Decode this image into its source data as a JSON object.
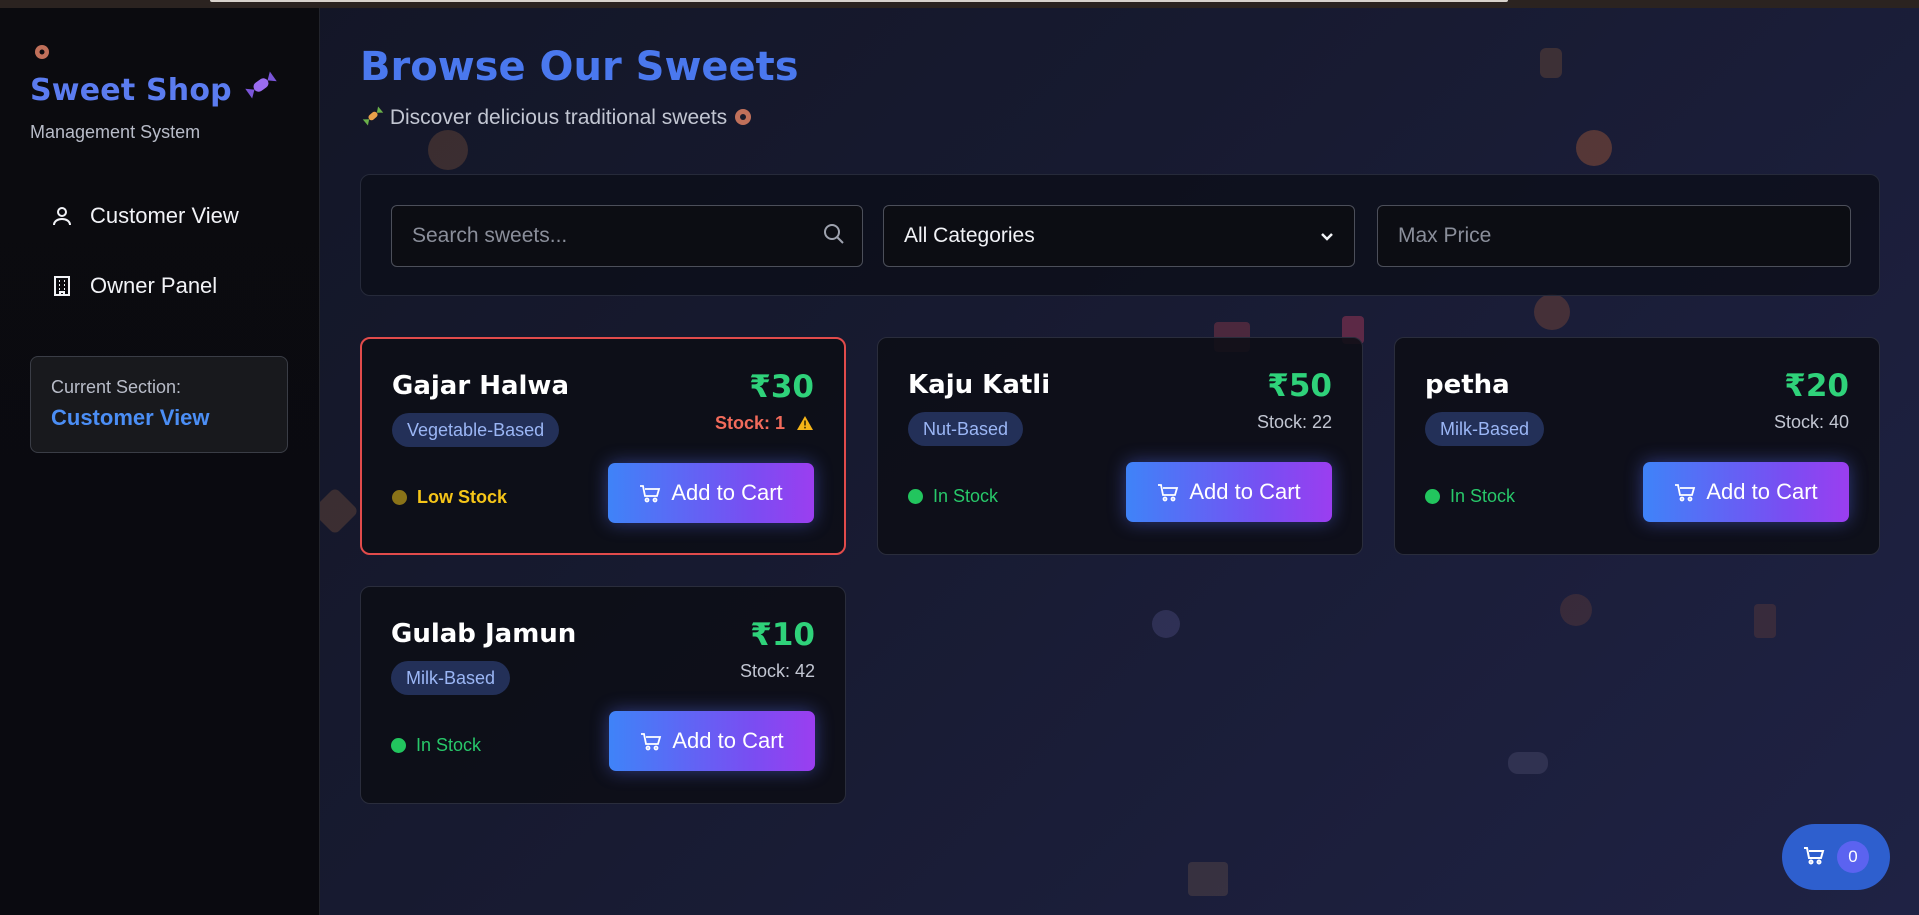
{
  "sidebar": {
    "brand_icon": "donut-emoji",
    "brand_title": "Sweet Shop",
    "brand_title_icon": "candy-icon",
    "brand_subtitle": "Management System",
    "nav": [
      {
        "label": "Customer View",
        "icon": "user-icon"
      },
      {
        "label": "Owner Panel",
        "icon": "building-icon"
      }
    ],
    "current_section_label": "Current Section:",
    "current_section_value": "Customer View"
  },
  "header": {
    "title": "Browse Our Sweets",
    "subtitle": "Discover delicious traditional sweets",
    "subtitle_icons": [
      "candy-icon",
      "donut-icon"
    ]
  },
  "filters": {
    "search_placeholder": "Search sweets...",
    "category_selected": "All Categories",
    "max_price_placeholder": "Max Price"
  },
  "products": [
    {
      "name": "Gajar Halwa",
      "price": "₹30",
      "category": "Vegetable-Based",
      "stock": "Stock: 1",
      "status": "Low Stock",
      "low": true,
      "button": "Add to Cart"
    },
    {
      "name": "Kaju Katli",
      "price": "₹50",
      "category": "Nut-Based",
      "stock": "Stock: 22",
      "status": "In Stock",
      "low": false,
      "button": "Add to Cart"
    },
    {
      "name": "petha",
      "price": "₹20",
      "category": "Milk-Based",
      "stock": "Stock: 40",
      "status": "In Stock",
      "low": false,
      "button": "Add to Cart"
    },
    {
      "name": "Gulab Jamun",
      "price": "₹10",
      "category": "Milk-Based",
      "stock": "Stock: 42",
      "status": "In Stock",
      "low": false,
      "button": "Add to Cart"
    }
  ],
  "cart": {
    "count": "0",
    "icon": "cart-icon"
  },
  "colors": {
    "accent_blue": "#4a78ee",
    "price_green": "#2fd27a",
    "low_stock_red": "#e14b4b",
    "button_gradient_start": "#3f83f8",
    "button_gradient_end": "#9b3ef0"
  }
}
